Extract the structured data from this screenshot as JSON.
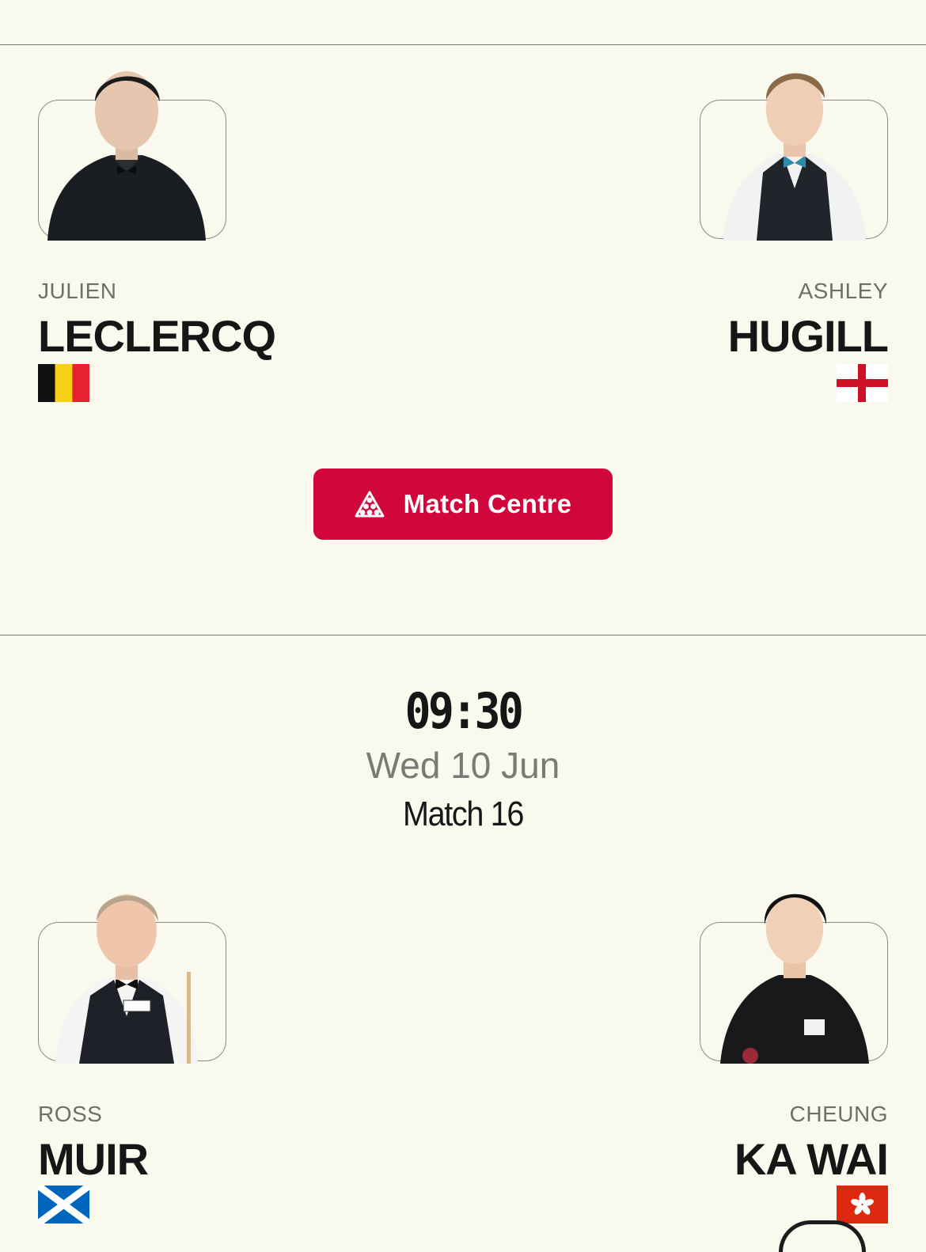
{
  "matches": [
    {
      "player_a": {
        "first_name": "JULIEN",
        "last_name": "LECLERCQ",
        "flag_icon": "belgium-flag-icon"
      },
      "player_b": {
        "first_name": "ASHLEY",
        "last_name": "HUGILL",
        "flag_icon": "england-flag-icon"
      },
      "button": {
        "label": "Match Centre",
        "icon": "snooker-balls-icon"
      }
    },
    {
      "time": "09:30",
      "date": "Wed 10 Jun",
      "match_number": "Match 16",
      "player_a": {
        "first_name": "ROSS",
        "last_name": "MUIR",
        "flag_icon": "scotland-flag-icon"
      },
      "player_b": {
        "first_name": "CHEUNG",
        "last_name": "KA WAI",
        "flag_icon": "hong-kong-flag-icon"
      }
    }
  ],
  "colors": {
    "background": "#f9f9ee",
    "accent": "#d1063a",
    "divider": "#7a7a72",
    "text_primary": "#161616",
    "text_secondary": "#6f6f6a"
  }
}
